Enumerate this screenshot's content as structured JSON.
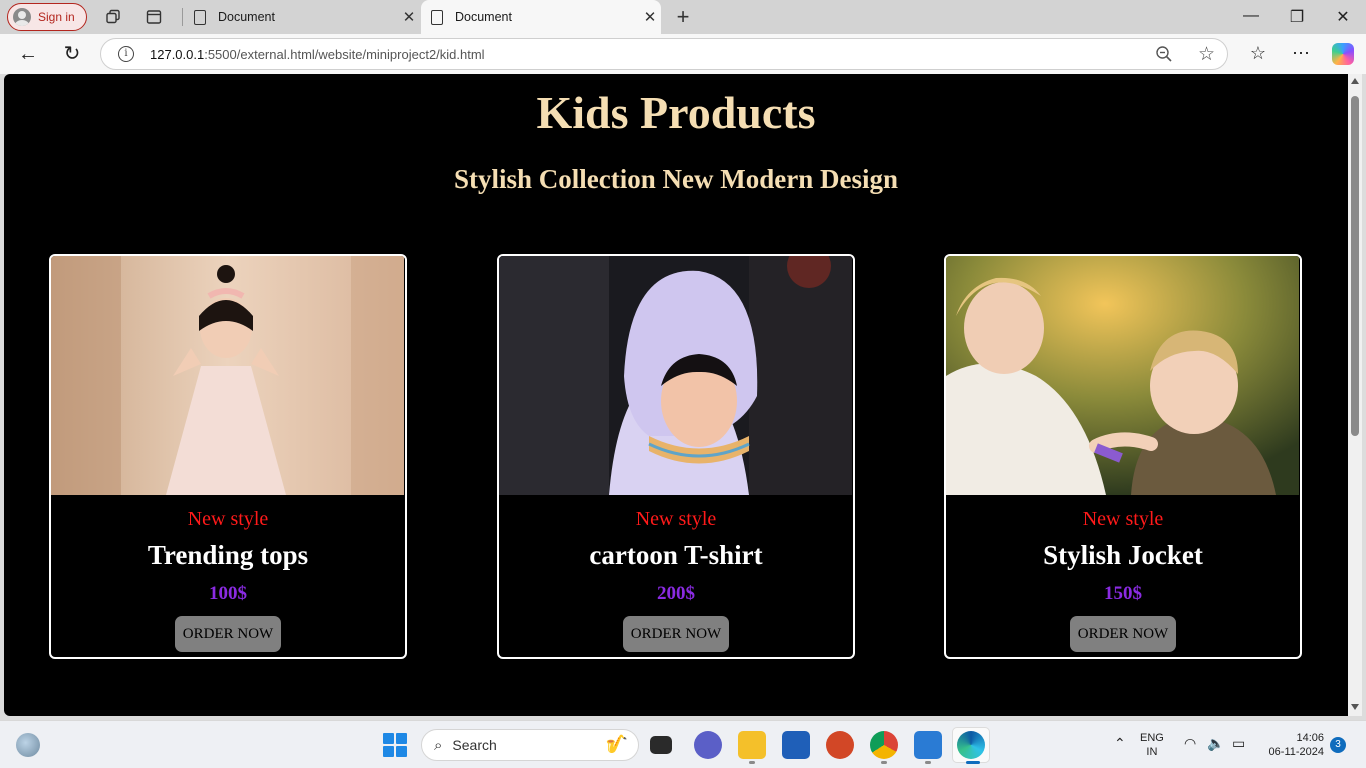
{
  "browser": {
    "signin_label": "Sign in",
    "tabs": [
      {
        "title": "Document",
        "active": false
      },
      {
        "title": "Document",
        "active": true
      }
    ],
    "url_host": "127.0.0.1",
    "url_rest": ":5500/external.html/website/miniproject2/kid.html"
  },
  "page": {
    "title": "Kids Products",
    "subtitle": "Stylish Collection New Modern Design",
    "products": [
      {
        "tag": "New style",
        "name": "Trending tops",
        "price": "100$",
        "button": "ORDER NOW"
      },
      {
        "tag": "New style",
        "name": "cartoon T-shirt",
        "price": "200$",
        "button": "ORDER NOW"
      },
      {
        "tag": "New style",
        "name": "Stylish Jocket",
        "price": "150$",
        "button": "ORDER NOW"
      }
    ]
  },
  "taskbar": {
    "search_placeholder": "Search",
    "lang_line1": "ENG",
    "lang_line2": "IN",
    "time": "14:06",
    "date": "06-11-2024",
    "notification_count": "3"
  },
  "colors": {
    "heading": "#f5deb3",
    "tag": "#ff1a1a",
    "price": "#8a2be2",
    "button": "#808080",
    "page_bg": "#000000"
  }
}
